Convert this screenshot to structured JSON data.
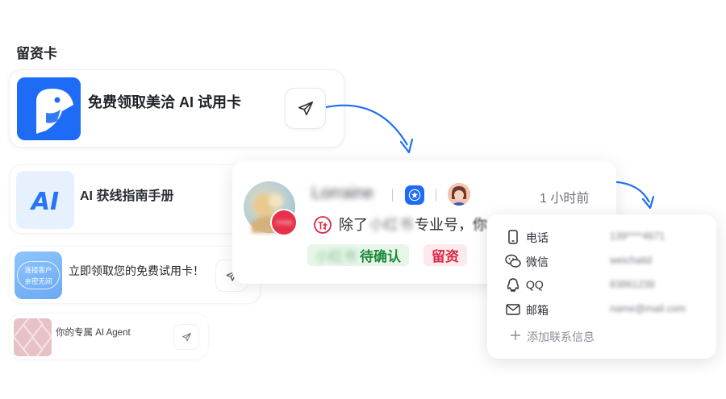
{
  "section_title": "留资卡",
  "cards": [
    {
      "title": "免费领取美洽 AI 试用卡"
    },
    {
      "title": "AI 获线指南手册",
      "thumb_text": "AI"
    },
    {
      "title": "立即领取您的免费试用卡！",
      "thumb_line1": "连接客户",
      "thumb_line2": "亲密无间"
    },
    {
      "title": "你的专属 AI Agent"
    }
  ],
  "chat": {
    "avatar_badge": "meiqia",
    "name": "Lorraine",
    "time": "1 小时前",
    "message_prefix": "除了",
    "message_blurred": "小红书",
    "message_suffix": "专业号，",
    "message_tail": "你",
    "tag_blurred": "小红书",
    "tag_pending": "待确认",
    "tag_lead": "留资"
  },
  "contact": {
    "rows": [
      {
        "icon": "phone-icon",
        "label": "电话",
        "value": "139****4671"
      },
      {
        "icon": "wechat-icon",
        "label": "微信",
        "value": "weichatid"
      },
      {
        "icon": "qq-icon",
        "label": "QQ",
        "value": "83861239"
      },
      {
        "icon": "mail-icon",
        "label": "邮箱",
        "value": "name@mail.com"
      }
    ],
    "add_label": "添加联系信息"
  },
  "colors": {
    "brand_blue": "#1e6cf6",
    "pending_green": "#1b8a3b",
    "lead_red": "#d52a46",
    "badge_red": "#e8304a"
  }
}
